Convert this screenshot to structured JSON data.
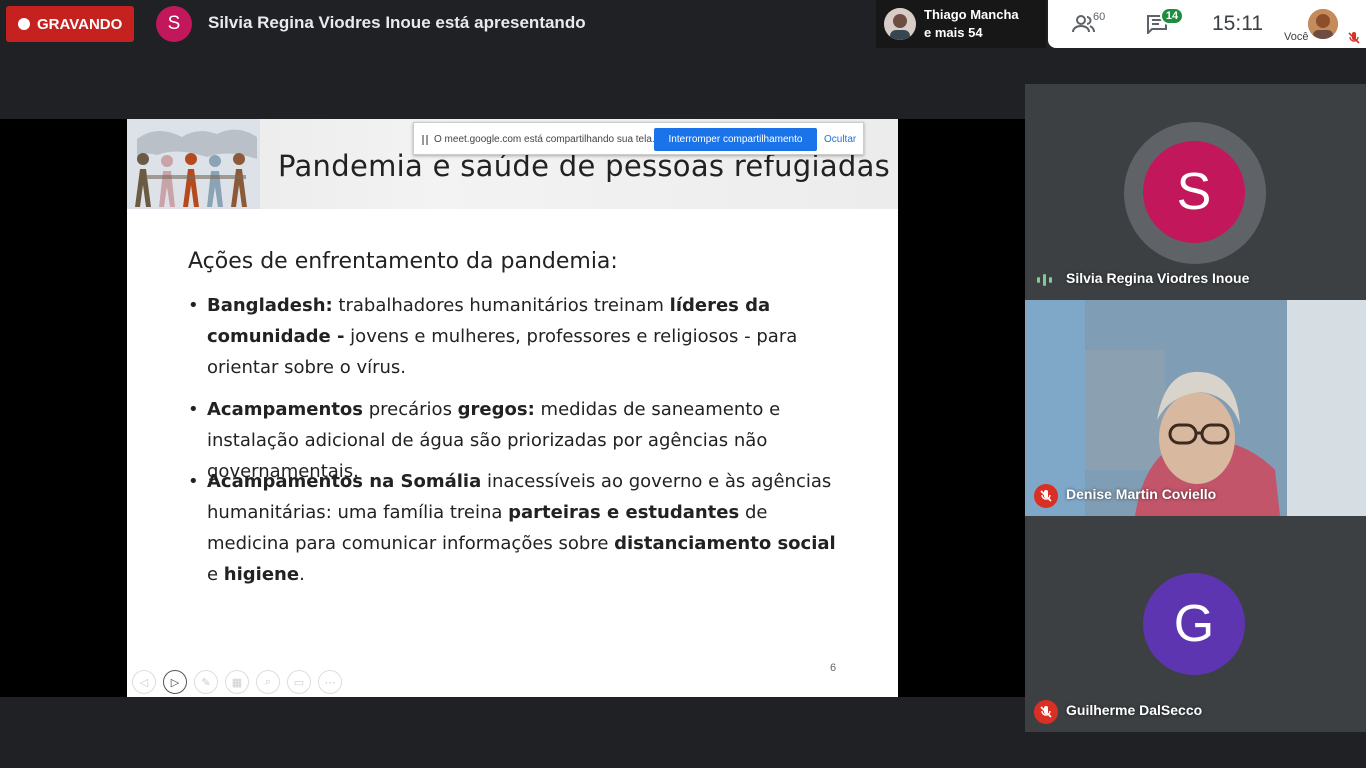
{
  "topbar": {
    "recording_label": "GRAVANDO",
    "presenter_initial": "S",
    "presenting_text": "Silvia Regina Viodres Inoue está apresentando",
    "participants_chip": {
      "line1": "Thiago Mancha",
      "line2": "e mais 54"
    },
    "people_count": "60",
    "chat_count": "14",
    "clock": "15:11",
    "self_label": "Você"
  },
  "share_bar": {
    "text": "O meet.google.com está compartilhando sua tela.",
    "stop_label": "Interromper compartilhamento",
    "hide_label": "Ocultar"
  },
  "slide": {
    "title": "Pandemia e saúde de pessoas refugiadas",
    "subtitle": "Ações de enfrentamento da pandemia:",
    "bullets": [
      {
        "b1_bold": "Bangladesh:",
        "b1_t1": " trabalhadores humanitários treinam ",
        "b1_bold2": "líderes da comunidade -",
        "b1_t2": "  jovens e mulheres, professores e religiosos - para orientar sobre o vírus."
      },
      {
        "b2_bold": "Acampamentos",
        "b2_t1": " precários ",
        "b2_bold2": "gregos:",
        "b2_t2": " medidas de saneamento e instalação adicional de água são priorizadas por agências não governamentais."
      },
      {
        "b3_bold": "Acampamentos na Somália",
        "b3_t1": " inacessíveis ao governo e às agências humanitárias: uma família  treina ",
        "b3_bold2": "parteiras e estudantes",
        "b3_t2": " de medicina para comunicar informações sobre ",
        "b3_bold3": "distanciamento social",
        "b3_t3": " e  ",
        "b3_bold4": "higiene",
        "b3_t4": "."
      }
    ],
    "page_number": "6"
  },
  "tiles": [
    {
      "initial": "S",
      "name": "Silvia Regina Viodres Inoue",
      "color": "#c2185b"
    },
    {
      "name": "Denise Martin Coviello"
    },
    {
      "initial": "G",
      "name": "Guilherme DalSecco",
      "color": "#5e35b1"
    }
  ],
  "colors": {
    "recording": "#c5221f",
    "accent_blue": "#1a73e8",
    "mute_red": "#d93025",
    "chat_green": "#1e8e3e"
  }
}
